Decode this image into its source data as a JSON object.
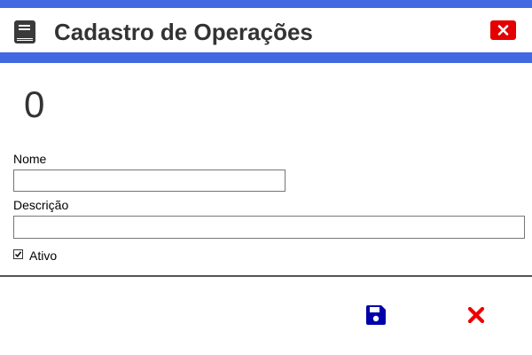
{
  "window": {
    "title": "Cadastro de Operações",
    "title_icon": "book-icon",
    "close_icon": "close-icon"
  },
  "form": {
    "id_value": "0",
    "nome": {
      "label": "Nome",
      "value": "",
      "placeholder": ""
    },
    "descricao": {
      "label": "Descrição",
      "value": "",
      "placeholder": ""
    },
    "ativo": {
      "label": "Ativo",
      "checked": true
    }
  },
  "footer": {
    "save_icon": "floppy-disk-icon",
    "cancel_icon": "cancel-x-icon"
  },
  "colors": {
    "header_accent": "#4169e1",
    "close_button": "#e50000",
    "save_icon": "#0000aa",
    "cancel_icon": "#ee0000",
    "title_text": "#333333"
  }
}
